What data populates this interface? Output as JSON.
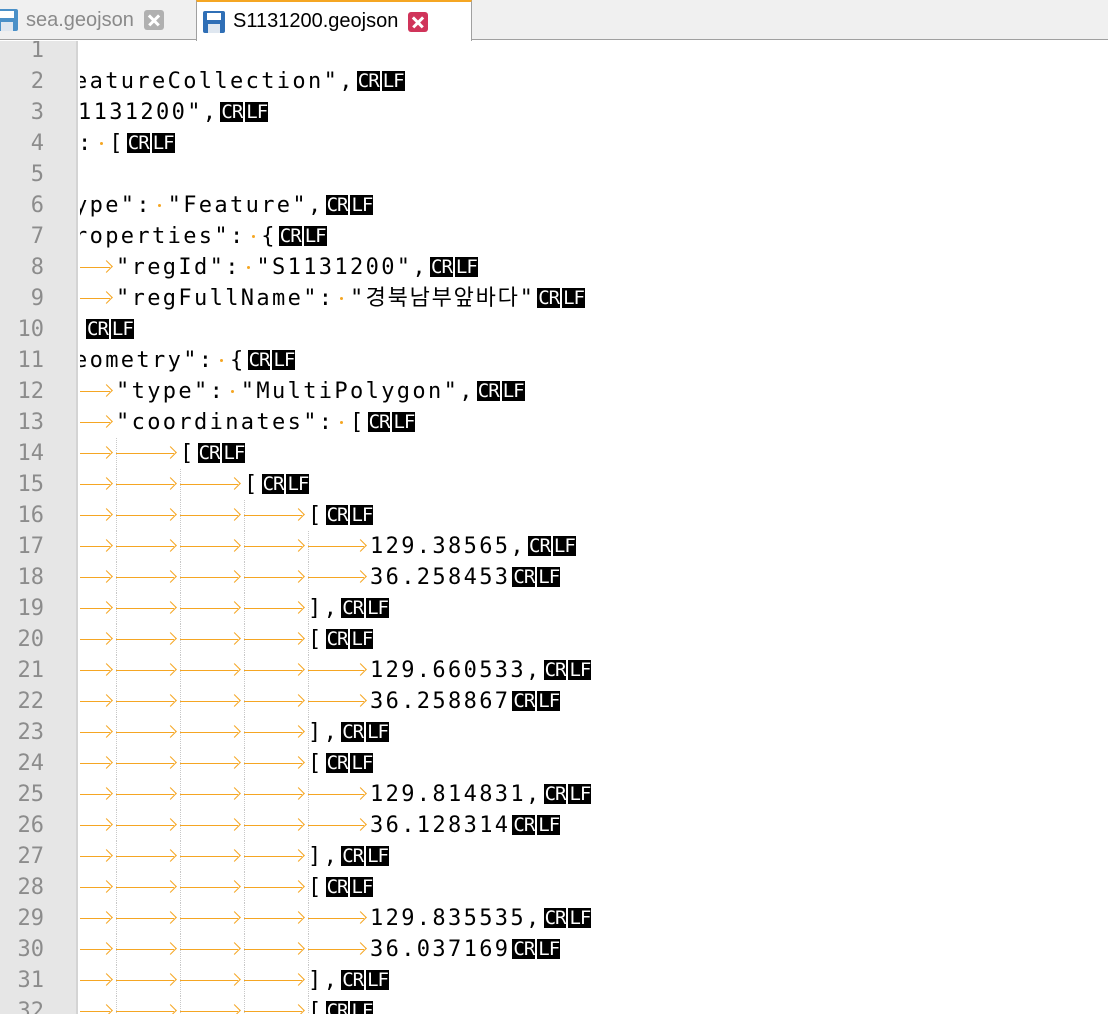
{
  "tabs": [
    {
      "label": "sea.geojson",
      "active": false
    },
    {
      "label": "S1131200.geojson",
      "active": true
    }
  ],
  "colors": {
    "accent": "#f5a623",
    "save_icon_inactive": "#4a90c8",
    "save_icon_active": "#2f6fb6",
    "close_inactive": "#b0b0b0",
    "close_active": "#d0345a"
  },
  "eol_marker": [
    "CR",
    "LF"
  ],
  "lines": [
    {
      "n": "1",
      "text": "",
      "eol": false
    },
    {
      "n": "2",
      "text": "eatureCollection\",",
      "eol": true
    },
    {
      "n": "3",
      "text": "1131200\",",
      "eol": true
    },
    {
      "n": "4",
      "text": ":·[",
      "eol": true
    },
    {
      "n": "5",
      "text": "",
      "eol": false
    },
    {
      "n": "6",
      "text": "ype\":·\"Feature\",",
      "eol": true
    },
    {
      "n": "7",
      "text": "roperties\":·{",
      "eol": true
    },
    {
      "n": "8",
      "text": "\"regId\":·\"S1131200\",",
      "eol": true
    },
    {
      "n": "9",
      "text": "\"regFullName\":·\"경북남부앞바다\"",
      "eol": true
    },
    {
      "n": "10",
      "text": "",
      "eol": true
    },
    {
      "n": "11",
      "text": "eometry\":·{",
      "eol": true
    },
    {
      "n": "12",
      "text": "\"type\":·\"MultiPolygon\",",
      "eol": true
    },
    {
      "n": "13",
      "text": "\"coordinates\":·[",
      "eol": true
    },
    {
      "n": "14",
      "text": "[",
      "eol": true
    },
    {
      "n": "15",
      "text": "[",
      "eol": true
    },
    {
      "n": "16",
      "text": "[",
      "eol": true
    },
    {
      "n": "17",
      "text": "129.38565,",
      "eol": true
    },
    {
      "n": "18",
      "text": "36.258453",
      "eol": true
    },
    {
      "n": "19",
      "text": "],",
      "eol": true
    },
    {
      "n": "20",
      "text": "[",
      "eol": true
    },
    {
      "n": "21",
      "text": "129.660533,",
      "eol": true
    },
    {
      "n": "22",
      "text": "36.258867",
      "eol": true
    },
    {
      "n": "23",
      "text": "],",
      "eol": true
    },
    {
      "n": "24",
      "text": "[",
      "eol": true
    },
    {
      "n": "25",
      "text": "129.814831,",
      "eol": true
    },
    {
      "n": "26",
      "text": "36.128314",
      "eol": true
    },
    {
      "n": "27",
      "text": "],",
      "eol": true
    },
    {
      "n": "28",
      "text": "[",
      "eol": true
    },
    {
      "n": "29",
      "text": "129.835535,",
      "eol": true
    },
    {
      "n": "30",
      "text": "36.037169",
      "eol": true
    },
    {
      "n": "31",
      "text": "],",
      "eol": true
    },
    {
      "n": "32",
      "text": "[",
      "eol": true
    }
  ]
}
